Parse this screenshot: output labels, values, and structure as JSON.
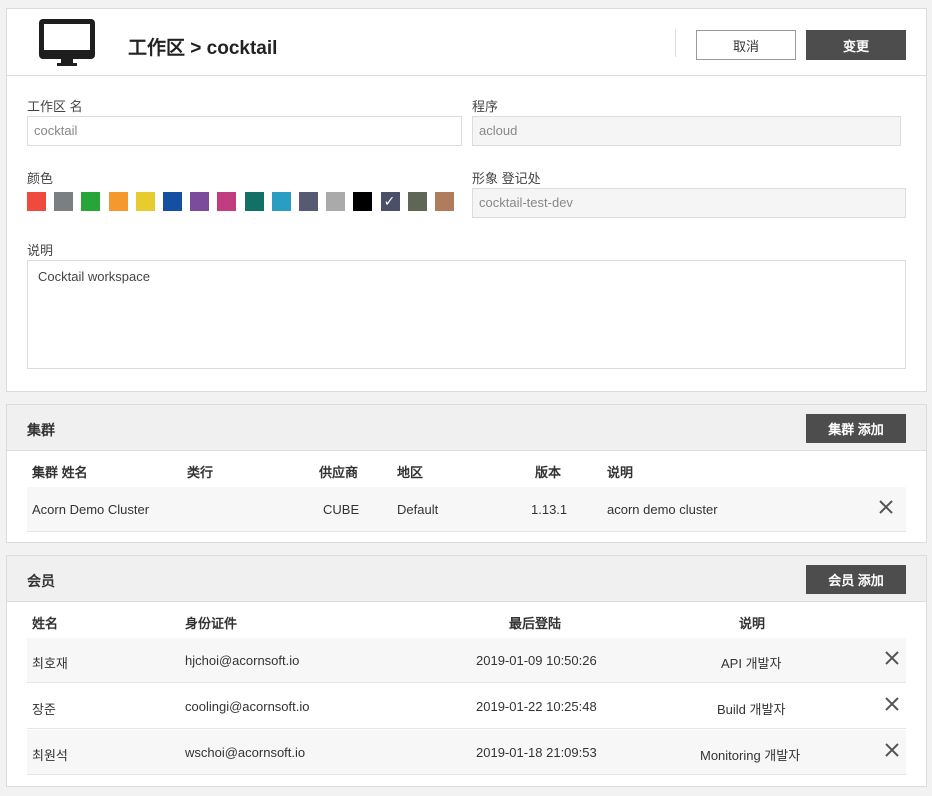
{
  "header": {
    "title": "工作区 > cocktail",
    "cancel_label": "取消",
    "change_label": "变更"
  },
  "form": {
    "workspace_name_label": "工作区 名",
    "workspace_name_value": "cocktail",
    "program_label": "程序",
    "program_value": "acloud",
    "color_label": "颜色",
    "colors": [
      "#f04a3e",
      "#7a7f84",
      "#27a537",
      "#f5992e",
      "#e6cc2e",
      "#1350a3",
      "#7a4c9b",
      "#c23c80",
      "#137064",
      "#2a9dc3",
      "#565a72",
      "#aaaaaa",
      "#000000",
      "#4a5068",
      "#5e6655",
      "#b07d5c"
    ],
    "selected_color_index": 13,
    "registry_label": "形象 登记处",
    "registry_value": "cocktail-test-dev",
    "description_label": "说明",
    "description_value": "Cocktail workspace"
  },
  "clusters": {
    "title": "集群",
    "add_label": "集群 添加",
    "columns": [
      "集群 姓名",
      "类行",
      "供应商",
      "地区",
      "版本",
      "说明"
    ],
    "rows": [
      {
        "name": "Acorn Demo Cluster",
        "type": "",
        "provider": "CUBE",
        "region": "Default",
        "version": "1.13.1",
        "description": "acorn demo cluster"
      }
    ]
  },
  "members": {
    "title": "会员",
    "add_label": "会员 添加",
    "columns": [
      "姓名",
      "身份证件",
      "最后登陆",
      "说明"
    ],
    "rows": [
      {
        "name": "최호재",
        "id": "hjchoi@acornsoft.io",
        "last_login": "2019-01-09 10:50:26",
        "description": "API 개발자"
      },
      {
        "name": "장준",
        "id": "coolingi@acornsoft.io",
        "last_login": "2019-01-22 10:25:48",
        "description": "Build 개발자"
      },
      {
        "name": "최원석",
        "id": "wschoi@acornsoft.io",
        "last_login": "2019-01-18 21:09:53",
        "description": "Monitoring 개발자"
      }
    ]
  }
}
